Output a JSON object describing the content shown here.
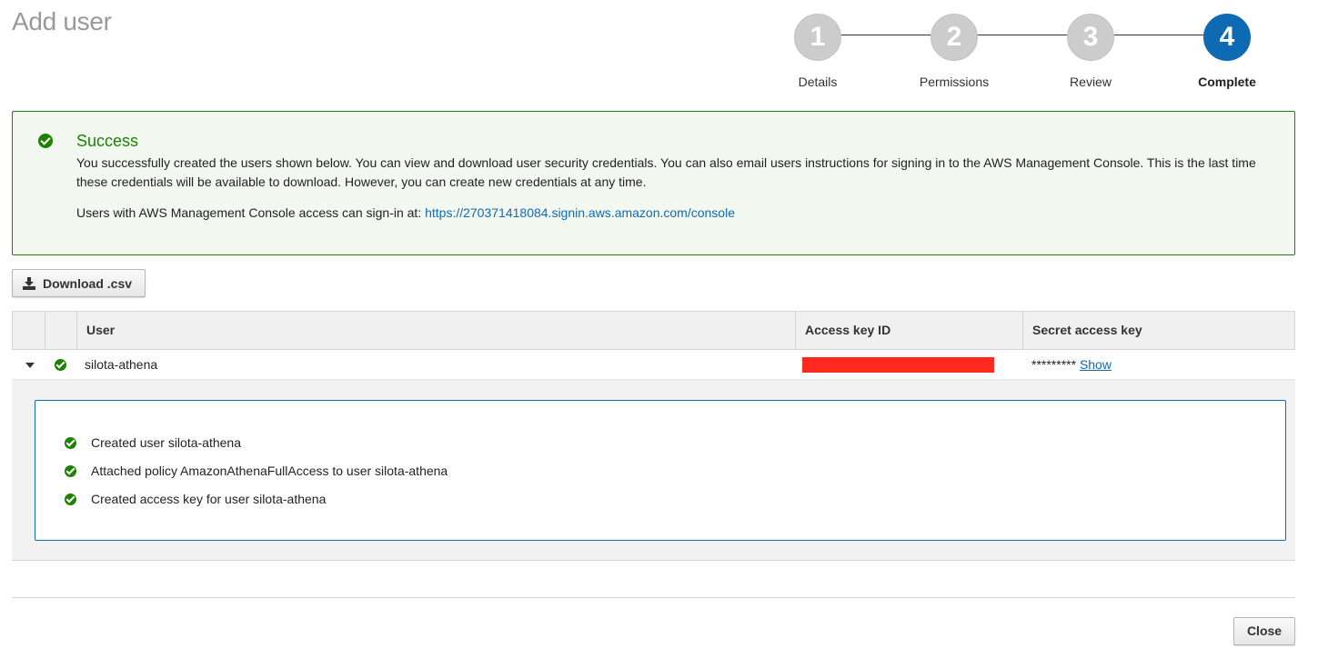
{
  "page": {
    "title": "Add user"
  },
  "wizard": {
    "steps": [
      {
        "number": "1",
        "label": "Details",
        "active": false
      },
      {
        "number": "2",
        "label": "Permissions",
        "active": false
      },
      {
        "number": "3",
        "label": "Review",
        "active": false
      },
      {
        "number": "4",
        "label": "Complete",
        "active": true
      }
    ]
  },
  "success": {
    "title": "Success",
    "message": "You successfully created the users shown below. You can view and download user security credentials. You can also email users instructions for signing in to the AWS Management Console. This is the last time these credentials will be available to download. However, you can create new credentials at any time.",
    "signin_prefix": "Users with AWS Management Console access can sign-in at: ",
    "signin_url": "https://270371418084.signin.aws.amazon.com/console"
  },
  "actions": {
    "download_label": "Download .csv",
    "close_label": "Close"
  },
  "table": {
    "columns": [
      "User",
      "Access key ID",
      "Secret access key"
    ],
    "rows": [
      {
        "user": "silota-athena",
        "access_key_id": "",
        "secret_masked": "*********",
        "show_label": "Show"
      }
    ]
  },
  "details": {
    "log": [
      "Created user silota-athena",
      "Attached policy AmazonAthenaFullAccess to user silota-athena",
      "Created access key for user silota-athena"
    ]
  },
  "colors": {
    "success": "#1d8102",
    "active_step": "#0f6ab4",
    "inactive_step": "#cccccc",
    "link": "#0f6ab4",
    "redaction": "#ff2a1f"
  }
}
